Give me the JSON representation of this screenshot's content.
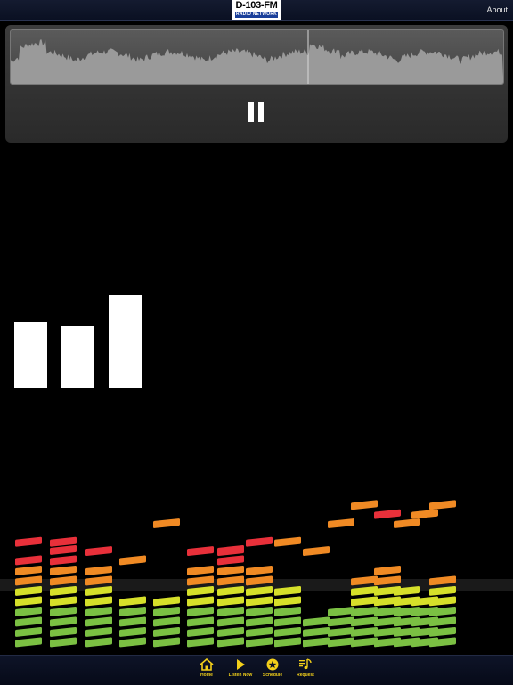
{
  "header": {
    "logo_line1": "D-103-FM",
    "logo_line2": "RADIO NETWORK",
    "about_label": "About"
  },
  "player": {
    "state": "playing",
    "pause_icon": "pause-icon"
  },
  "level_meter": {
    "levels": [
      0.4,
      0.37,
      0.56
    ]
  },
  "tabs": [
    {
      "label": "Home",
      "icon": "home-icon"
    },
    {
      "label": "Listen Now",
      "icon": "play-icon"
    },
    {
      "label": "Schedule",
      "icon": "star-icon"
    },
    {
      "label": "Request",
      "icon": "music-note-icon"
    }
  ],
  "colors": {
    "tab_accent": "#f2cf1a",
    "bar_background": "#0a1022"
  }
}
